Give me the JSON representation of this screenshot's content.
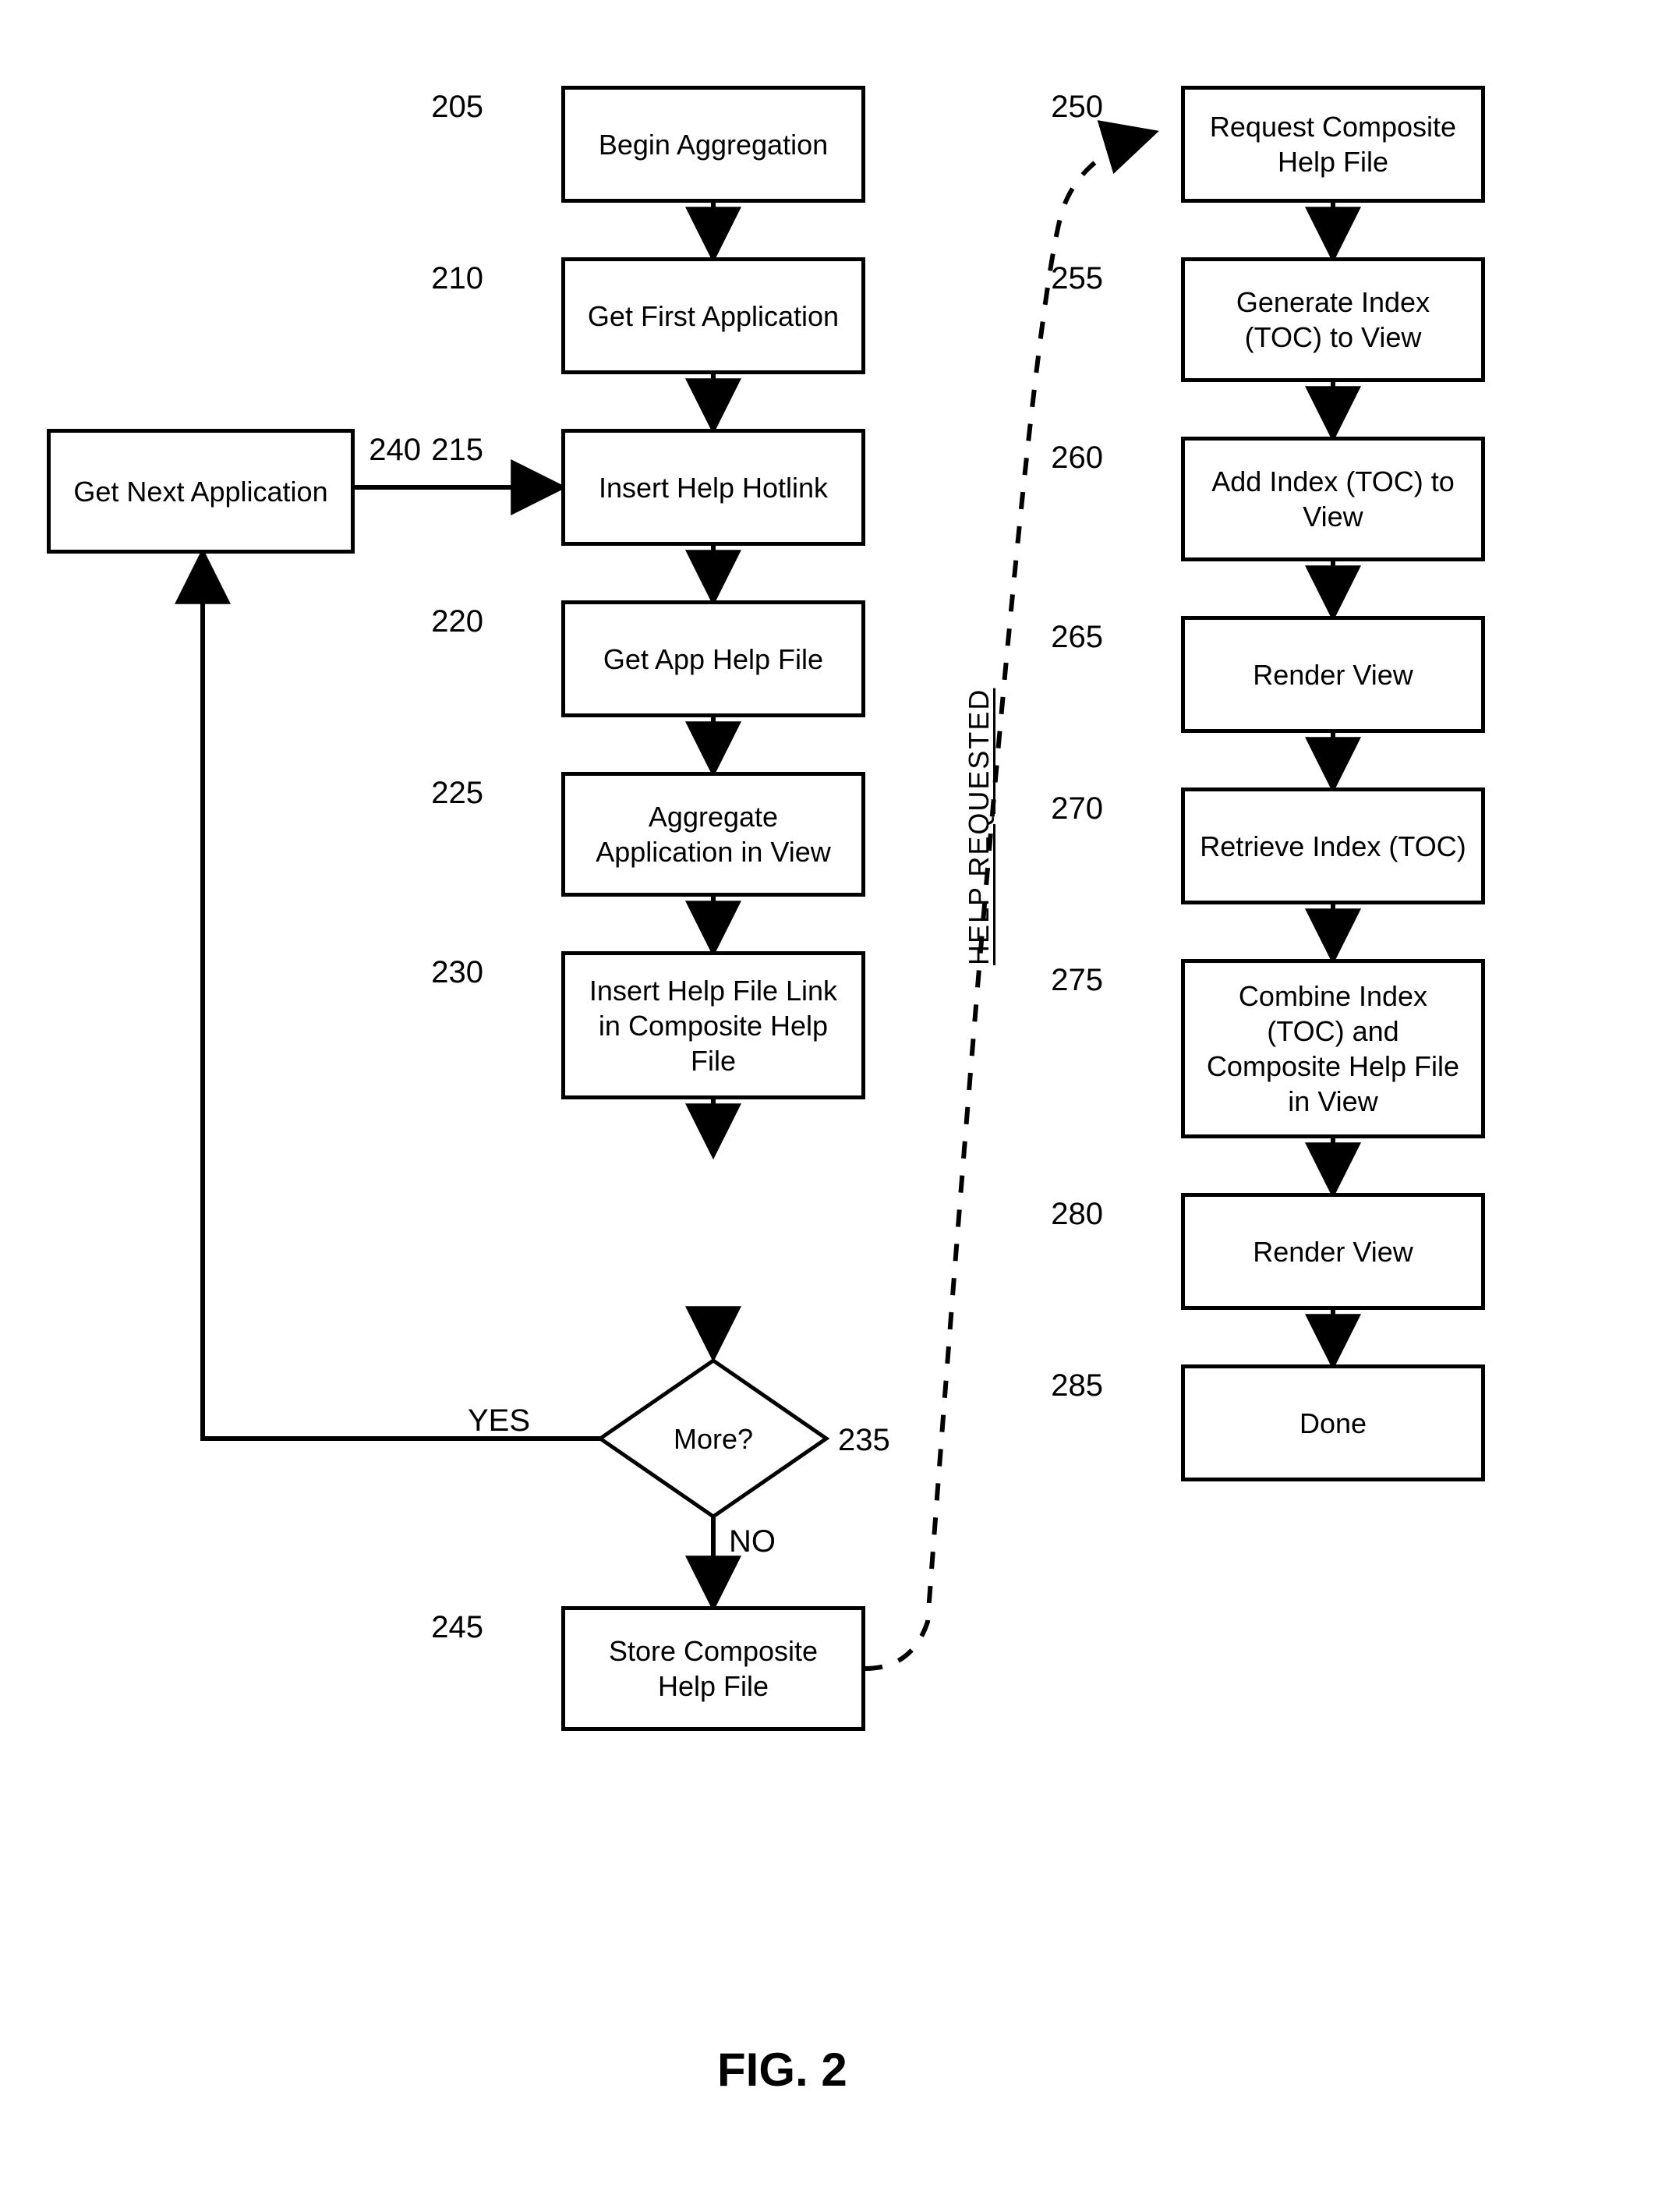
{
  "chart_data": {
    "type": "flowchart",
    "title": "FIG. 2",
    "nodes": [
      {
        "id": "205",
        "label": "Begin Aggregation",
        "shape": "rect"
      },
      {
        "id": "210",
        "label": "Get First Application",
        "shape": "rect"
      },
      {
        "id": "215",
        "label": "Insert Help Hotlink",
        "shape": "rect"
      },
      {
        "id": "220",
        "label": "Get App Help File",
        "shape": "rect"
      },
      {
        "id": "225",
        "label": "Aggregate Application in View",
        "shape": "rect"
      },
      {
        "id": "230",
        "label": "Insert Help File Link in Composite Help File",
        "shape": "rect"
      },
      {
        "id": "235",
        "label": "More?",
        "shape": "decision"
      },
      {
        "id": "240",
        "label": "Get Next Application",
        "shape": "rect"
      },
      {
        "id": "245",
        "label": "Store Composite Help File",
        "shape": "rect"
      },
      {
        "id": "250",
        "label": "Request Composite Help File",
        "shape": "rect"
      },
      {
        "id": "255",
        "label": "Generate Index (TOC) to View",
        "shape": "rect"
      },
      {
        "id": "260",
        "label": "Add Index (TOC) to View",
        "shape": "rect"
      },
      {
        "id": "265",
        "label": "Render View",
        "shape": "rect"
      },
      {
        "id": "270",
        "label": "Retrieve Index (TOC)",
        "shape": "rect"
      },
      {
        "id": "275",
        "label": "Combine Index (TOC) and Composite Help File in View",
        "shape": "rect"
      },
      {
        "id": "280",
        "label": "Render View",
        "shape": "rect"
      },
      {
        "id": "285",
        "label": "Done",
        "shape": "rect"
      }
    ],
    "edges": [
      {
        "from": "205",
        "to": "210"
      },
      {
        "from": "210",
        "to": "215"
      },
      {
        "from": "215",
        "to": "220"
      },
      {
        "from": "220",
        "to": "225"
      },
      {
        "from": "225",
        "to": "230"
      },
      {
        "from": "230",
        "to": "235"
      },
      {
        "from": "235",
        "to": "240",
        "label": "YES"
      },
      {
        "from": "235",
        "to": "245",
        "label": "NO"
      },
      {
        "from": "240",
        "to": "215"
      },
      {
        "from": "245",
        "to": "250",
        "label": "HELP REQUESTED",
        "style": "dashed"
      },
      {
        "from": "250",
        "to": "255"
      },
      {
        "from": "255",
        "to": "260"
      },
      {
        "from": "260",
        "to": "265"
      },
      {
        "from": "265",
        "to": "270"
      },
      {
        "from": "270",
        "to": "275"
      },
      {
        "from": "275",
        "to": "280"
      },
      {
        "from": "280",
        "to": "285"
      }
    ]
  },
  "labels": {
    "n205": "205",
    "n210": "210",
    "n215": "215",
    "n220": "220",
    "n225": "225",
    "n230": "230",
    "n235": "235",
    "n240": "240",
    "n245": "245",
    "n250": "250",
    "n255": "255",
    "n260": "260",
    "n265": "265",
    "n270": "270",
    "n275": "275",
    "n280": "280",
    "n285": "285",
    "b205": "Begin Aggregation",
    "b210": "Get First Application",
    "b215": "Insert Help Hotlink",
    "b220": "Get App Help File",
    "b225": "Aggregate\nApplication in View",
    "b230": "Insert Help File Link\nin Composite Help\nFile",
    "b235": "More?",
    "b240": "Get Next Application",
    "b245": "Store Composite\nHelp File",
    "b250": "Request Composite\nHelp File",
    "b255": "Generate Index\n(TOC) to View",
    "b260": "Add Index (TOC) to\nView",
    "b265": "Render View",
    "b270": "Retrieve Index (TOC)",
    "b275": "Combine Index\n(TOC) and\nComposite Help File\nin View",
    "b280": "Render View",
    "b285": "Done",
    "yes": "YES",
    "no": "NO",
    "help": "HELP REQUESTED",
    "fig": "FIG. 2"
  }
}
